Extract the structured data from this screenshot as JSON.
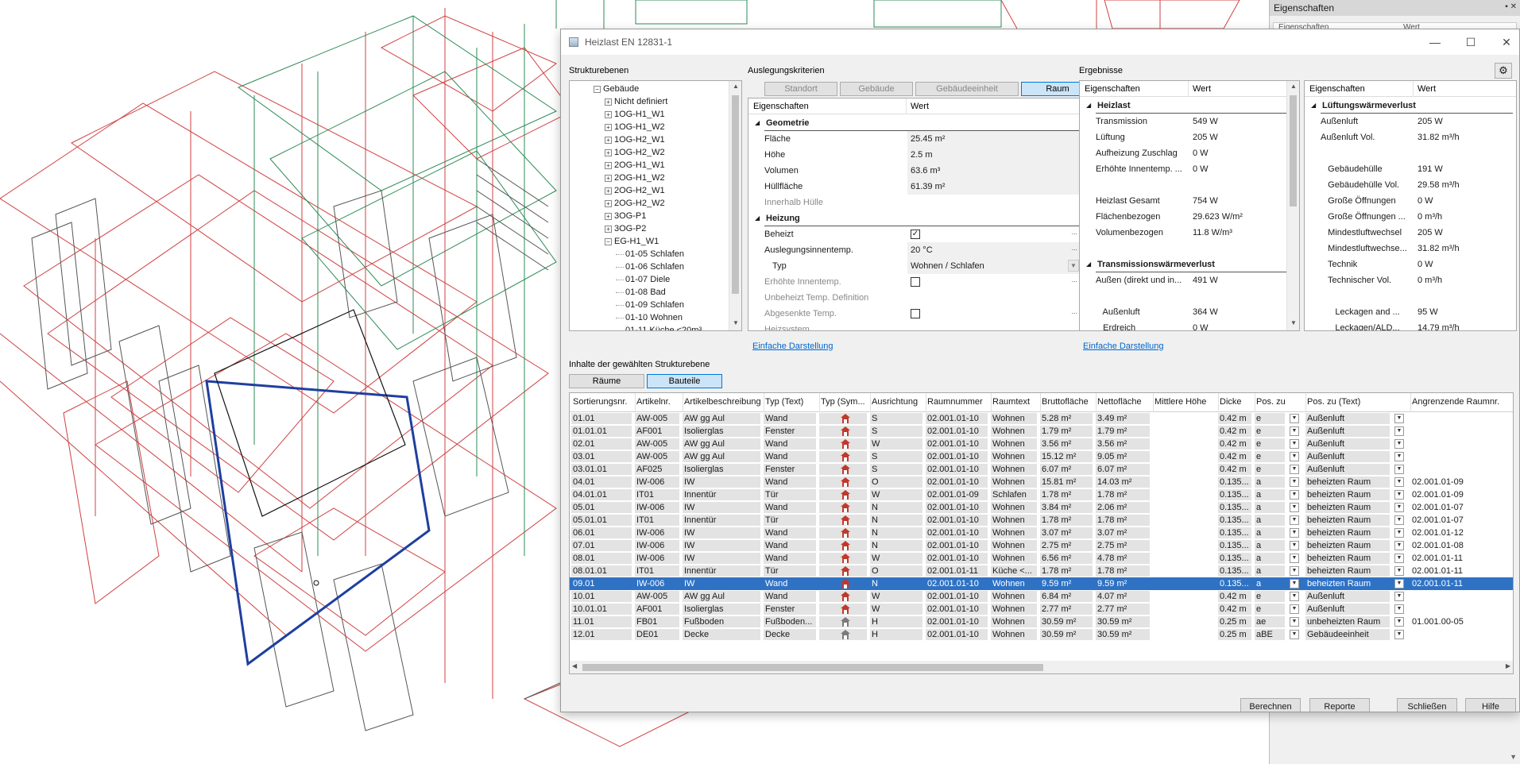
{
  "window": {
    "title": "Heizlast EN 12831-1",
    "controls": {
      "minimize": "—",
      "maximize": "☐",
      "close": "✕"
    }
  },
  "side_panel": {
    "title": "Eigenschaften",
    "header_left": "Eigenschaften",
    "header_right": "Wert"
  },
  "settings_icon": "gear-icon",
  "structure": {
    "label": "Strukturebenen",
    "items": [
      {
        "text": "Gebäude",
        "level": 0,
        "toggle": "−"
      },
      {
        "text": "Nicht definiert",
        "level": 1,
        "toggle": "+"
      },
      {
        "text": "1OG-H1_W1",
        "level": 1,
        "toggle": "+"
      },
      {
        "text": "1OG-H1_W2",
        "level": 1,
        "toggle": "+"
      },
      {
        "text": "1OG-H2_W1",
        "level": 1,
        "toggle": "+"
      },
      {
        "text": "1OG-H2_W2",
        "level": 1,
        "toggle": "+"
      },
      {
        "text": "2OG-H1_W1",
        "level": 1,
        "toggle": "+"
      },
      {
        "text": "2OG-H1_W2",
        "level": 1,
        "toggle": "+"
      },
      {
        "text": "2OG-H2_W1",
        "level": 1,
        "toggle": "+"
      },
      {
        "text": "2OG-H2_W2",
        "level": 1,
        "toggle": "+"
      },
      {
        "text": "3OG-P1",
        "level": 1,
        "toggle": "+"
      },
      {
        "text": "3OG-P2",
        "level": 1,
        "toggle": "+"
      },
      {
        "text": "EG-H1_W1",
        "level": 1,
        "toggle": "−"
      },
      {
        "text": "01-05 Schlafen",
        "level": 2,
        "toggle": ""
      },
      {
        "text": "01-06 Schlafen",
        "level": 2,
        "toggle": ""
      },
      {
        "text": "01-07 Diele",
        "level": 2,
        "toggle": ""
      },
      {
        "text": "01-08 Bad",
        "level": 2,
        "toggle": ""
      },
      {
        "text": "01-09 Schlafen",
        "level": 2,
        "toggle": ""
      },
      {
        "text": "01-10 Wohnen",
        "level": 2,
        "toggle": ""
      },
      {
        "text": "01-11 Küche <20m³",
        "level": 2,
        "toggle": ""
      }
    ]
  },
  "criteria": {
    "label": "Auslegungskriterien",
    "tabs": [
      "Standort",
      "Gebäude",
      "Gebäudeeinheit",
      "Raum"
    ],
    "active_tab": "Raum",
    "header": {
      "left": "Eigenschaften",
      "right": "Wert"
    },
    "rows": [
      {
        "type": "group",
        "label": "Geometrie"
      },
      {
        "type": "value",
        "label": "Fläche",
        "value": "25.45 m²"
      },
      {
        "type": "value",
        "label": "Höhe",
        "value": "2.5 m"
      },
      {
        "type": "value",
        "label": "Volumen",
        "value": "63.6 m³"
      },
      {
        "type": "value",
        "label": "Hüllfläche",
        "value": "61.39 m²"
      },
      {
        "type": "disabled",
        "label": "Innerhalb Hülle",
        "value": ""
      },
      {
        "type": "group",
        "label": "Heizung"
      },
      {
        "type": "check",
        "label": "Beheizt",
        "checked": true,
        "ellipsis": "..."
      },
      {
        "type": "value",
        "label": "Auslegungsinnentemp.",
        "value": "20 °C",
        "ellipsis": "..."
      },
      {
        "type": "dropdown",
        "label": "Typ",
        "value": "Wohnen / Schlafen"
      },
      {
        "type": "check-disabled",
        "label": "Erhöhte Innentemp.",
        "checked": false,
        "ellipsis": "..."
      },
      {
        "type": "disabled",
        "label": "Unbeheizt Temp. Definition",
        "value": ""
      },
      {
        "type": "check-disabled",
        "label": "Abgesenkte Temp.",
        "checked": false,
        "ellipsis": "..."
      },
      {
        "type": "disabled",
        "label": "Heizsystem",
        "value": ""
      }
    ],
    "link": "Einfache Darstellung"
  },
  "results": {
    "label": "Ergebnisse",
    "link": "Einfache Darstellung",
    "left": {
      "header": {
        "left": "Eigenschaften",
        "right": "Wert"
      },
      "rows": [
        {
          "type": "group",
          "label": "Heizlast"
        },
        {
          "type": "value",
          "label": "Transmission",
          "value": "549 W"
        },
        {
          "type": "value",
          "label": "Lüftung",
          "value": "205 W"
        },
        {
          "type": "value",
          "label": "Aufheizung Zuschlag",
          "value": "0 W"
        },
        {
          "type": "value",
          "label": "Erhöhte Innentemp. ...",
          "value": "0 W"
        },
        {
          "type": "blank"
        },
        {
          "type": "value",
          "label": "Heizlast Gesamt",
          "value": "754 W"
        },
        {
          "type": "value",
          "label": "Flächenbezogen",
          "value": "29.623 W/m²"
        },
        {
          "type": "value",
          "label": "Volumenbezogen",
          "value": "11.8 W/m³"
        },
        {
          "type": "blank"
        },
        {
          "type": "group",
          "label": "Transmissionswärmeverlust"
        },
        {
          "type": "value",
          "label": "Außen (direkt und in...",
          "value": "491 W"
        },
        {
          "type": "blank"
        },
        {
          "type": "value",
          "label": "   Außenluft",
          "value": "364 W"
        },
        {
          "type": "value",
          "label": "   Erdreich",
          "value": "0 W"
        }
      ]
    },
    "right": {
      "header": {
        "left": "Eigenschaften",
        "right": "Wert"
      },
      "rows": [
        {
          "type": "group",
          "label": "Lüftungswärmeverlust"
        },
        {
          "type": "value",
          "label": "Außenluft",
          "value": "205 W"
        },
        {
          "type": "value",
          "label": "Außenluft Vol.",
          "value": "31.82 m³/h"
        },
        {
          "type": "blank"
        },
        {
          "type": "value",
          "label": "   Gebäudehülle",
          "value": "191 W"
        },
        {
          "type": "value",
          "label": "   Gebäudehülle Vol.",
          "value": "29.58 m³/h"
        },
        {
          "type": "value",
          "label": "   Große Öffnungen",
          "value": "0 W"
        },
        {
          "type": "value",
          "label": "   Große Öffnungen ...",
          "value": "0 m³/h"
        },
        {
          "type": "value",
          "label": "   Mindestluftwechsel",
          "value": "205 W"
        },
        {
          "type": "value",
          "label": "   Mindestluftwechse...",
          "value": "31.82 m³/h"
        },
        {
          "type": "value",
          "label": "   Technik",
          "value": "0 W"
        },
        {
          "type": "value",
          "label": "   Technischer Vol.",
          "value": "0 m³/h"
        },
        {
          "type": "blank"
        },
        {
          "type": "value",
          "label": "      Leckagen and ...",
          "value": "95 W"
        },
        {
          "type": "value",
          "label": "      Leckagen/ALD...",
          "value": "14.79 m³/h"
        }
      ]
    }
  },
  "contents": {
    "label": "Inhalte der gewählten Strukturebene",
    "tabs": [
      "Räume",
      "Bauteile"
    ],
    "active_tab": "Bauteile",
    "columns": [
      "Sortierungsnr.",
      "Artikelnr.",
      "Artikelbeschreibung",
      "Typ (Text)",
      "Typ (Sym...",
      "Ausrichtung",
      "Raumnummer",
      "Raumtext",
      "Bruttofläche",
      "Nettofläche",
      "Mittlere Höhe",
      "Dicke",
      "Pos. zu",
      "Pos. zu (Text)",
      "Angrenzende Raumnr."
    ],
    "rows": [
      {
        "sort": "01.01",
        "art": "AW-005",
        "desc": "AW gg Aul",
        "typ": "Wand",
        "sym": "wall-symbol-icon",
        "ausr": "S",
        "raum": "02.001.01-10",
        "rtext": "Wohnen",
        "brutto": "5.28 m²",
        "netto": "3.49 m²",
        "hoehe": "",
        "dicke": "0.42 m",
        "pos": "e",
        "postext": "Außenluft",
        "angr": ""
      },
      {
        "sort": "01.01.01",
        "art": "AF001",
        "desc": "Isolierglas",
        "typ": "Fenster",
        "sym": "window-symbol-icon",
        "ausr": "S",
        "raum": "02.001.01-10",
        "rtext": "Wohnen",
        "brutto": "1.79 m²",
        "netto": "1.79 m²",
        "hoehe": "",
        "dicke": "0.42 m",
        "pos": "e",
        "postext": "Außenluft",
        "angr": ""
      },
      {
        "sort": "02.01",
        "art": "AW-005",
        "desc": "AW gg Aul",
        "typ": "Wand",
        "sym": "wall-symbol-icon",
        "ausr": "W",
        "raum": "02.001.01-10",
        "rtext": "Wohnen",
        "brutto": "3.56 m²",
        "netto": "3.56 m²",
        "hoehe": "",
        "dicke": "0.42 m",
        "pos": "e",
        "postext": "Außenluft",
        "angr": ""
      },
      {
        "sort": "03.01",
        "art": "AW-005",
        "desc": "AW gg Aul",
        "typ": "Wand",
        "sym": "wall-symbol-icon",
        "ausr": "S",
        "raum": "02.001.01-10",
        "rtext": "Wohnen",
        "brutto": "15.12 m²",
        "netto": "9.05 m²",
        "hoehe": "",
        "dicke": "0.42 m",
        "pos": "e",
        "postext": "Außenluft",
        "angr": ""
      },
      {
        "sort": "03.01.01",
        "art": "AF025",
        "desc": "Isolierglas",
        "typ": "Fenster",
        "sym": "window-symbol-icon",
        "ausr": "S",
        "raum": "02.001.01-10",
        "rtext": "Wohnen",
        "brutto": "6.07 m²",
        "netto": "6.07 m²",
        "hoehe": "",
        "dicke": "0.42 m",
        "pos": "e",
        "postext": "Außenluft",
        "angr": ""
      },
      {
        "sort": "04.01",
        "art": "IW-006",
        "desc": "IW",
        "typ": "Wand",
        "sym": "wall-symbol-icon",
        "ausr": "O",
        "raum": "02.001.01-10",
        "rtext": "Wohnen",
        "brutto": "15.81 m²",
        "netto": "14.03 m²",
        "hoehe": "",
        "dicke": "0.135...",
        "pos": "a",
        "postext": "beheizten Raum",
        "angr": "02.001.01-09"
      },
      {
        "sort": "04.01.01",
        "art": "IT01",
        "desc": "Innentür",
        "typ": "Tür",
        "sym": "door-symbol-icon",
        "ausr": "W",
        "raum": "02.001.01-09",
        "rtext": "Schlafen",
        "brutto": "1.78 m²",
        "netto": "1.78 m²",
        "hoehe": "",
        "dicke": "0.135...",
        "pos": "a",
        "postext": "beheizten Raum",
        "angr": "02.001.01-09"
      },
      {
        "sort": "05.01",
        "art": "IW-006",
        "desc": "IW",
        "typ": "Wand",
        "sym": "wall-symbol-icon",
        "ausr": "N",
        "raum": "02.001.01-10",
        "rtext": "Wohnen",
        "brutto": "3.84 m²",
        "netto": "2.06 m²",
        "hoehe": "",
        "dicke": "0.135...",
        "pos": "a",
        "postext": "beheizten Raum",
        "angr": "02.001.01-07"
      },
      {
        "sort": "05.01.01",
        "art": "IT01",
        "desc": "Innentür",
        "typ": "Tür",
        "sym": "door-symbol-icon",
        "ausr": "N",
        "raum": "02.001.01-10",
        "rtext": "Wohnen",
        "brutto": "1.78 m²",
        "netto": "1.78 m²",
        "hoehe": "",
        "dicke": "0.135...",
        "pos": "a",
        "postext": "beheizten Raum",
        "angr": "02.001.01-07"
      },
      {
        "sort": "06.01",
        "art": "IW-006",
        "desc": "IW",
        "typ": "Wand",
        "sym": "wall-symbol-icon",
        "ausr": "N",
        "raum": "02.001.01-10",
        "rtext": "Wohnen",
        "brutto": "3.07 m²",
        "netto": "3.07 m²",
        "hoehe": "",
        "dicke": "0.135...",
        "pos": "a",
        "postext": "beheizten Raum",
        "angr": "02.001.01-12"
      },
      {
        "sort": "07.01",
        "art": "IW-006",
        "desc": "IW",
        "typ": "Wand",
        "sym": "wall-symbol-icon",
        "ausr": "N",
        "raum": "02.001.01-10",
        "rtext": "Wohnen",
        "brutto": "2.75 m²",
        "netto": "2.75 m²",
        "hoehe": "",
        "dicke": "0.135...",
        "pos": "a",
        "postext": "beheizten Raum",
        "angr": "02.001.01-08"
      },
      {
        "sort": "08.01",
        "art": "IW-006",
        "desc": "IW",
        "typ": "Wand",
        "sym": "wall-symbol-icon",
        "ausr": "W",
        "raum": "02.001.01-10",
        "rtext": "Wohnen",
        "brutto": "6.56 m²",
        "netto": "4.78 m²",
        "hoehe": "",
        "dicke": "0.135...",
        "pos": "a",
        "postext": "beheizten Raum",
        "angr": "02.001.01-11"
      },
      {
        "sort": "08.01.01",
        "art": "IT01",
        "desc": "Innentür",
        "typ": "Tür",
        "sym": "door-symbol-icon",
        "ausr": "O",
        "raum": "02.001.01-11",
        "rtext": "Küche <...",
        "brutto": "1.78 m²",
        "netto": "1.78 m²",
        "hoehe": "",
        "dicke": "0.135...",
        "pos": "a",
        "postext": "beheizten Raum",
        "angr": "02.001.01-11"
      },
      {
        "sort": "09.01",
        "art": "IW-006",
        "desc": "IW",
        "typ": "Wand",
        "sym": "wall-symbol-icon",
        "ausr": "N",
        "raum": "02.001.01-10",
        "rtext": "Wohnen",
        "brutto": "9.59 m²",
        "netto": "9.59 m²",
        "hoehe": "",
        "dicke": "0.135...",
        "pos": "a",
        "postext": "beheizten Raum",
        "angr": "02.001.01-11",
        "selected": true
      },
      {
        "sort": "10.01",
        "art": "AW-005",
        "desc": "AW gg Aul",
        "typ": "Wand",
        "sym": "wall-symbol-icon",
        "ausr": "W",
        "raum": "02.001.01-10",
        "rtext": "Wohnen",
        "brutto": "6.84 m²",
        "netto": "4.07 m²",
        "hoehe": "",
        "dicke": "0.42 m",
        "pos": "e",
        "postext": "Außenluft",
        "angr": ""
      },
      {
        "sort": "10.01.01",
        "art": "AF001",
        "desc": "Isolierglas",
        "typ": "Fenster",
        "sym": "window-symbol-icon",
        "ausr": "W",
        "raum": "02.001.01-10",
        "rtext": "Wohnen",
        "brutto": "2.77 m²",
        "netto": "2.77 m²",
        "hoehe": "",
        "dicke": "0.42 m",
        "pos": "e",
        "postext": "Außenluft",
        "angr": ""
      },
      {
        "sort": "11.01",
        "art": "FB01",
        "desc": "Fußboden",
        "typ": "Fußboden...",
        "sym": "floor-symbol-icon",
        "ausr": "H",
        "raum": "02.001.01-10",
        "rtext": "Wohnen",
        "brutto": "30.59 m²",
        "netto": "30.59 m²",
        "hoehe": "",
        "dicke": "0.25 m",
        "pos": "ae",
        "postext": "unbeheizten Raum",
        "angr": "01.001.00-05"
      },
      {
        "sort": "12.01",
        "art": "DE01",
        "desc": "Decke",
        "typ": "Decke",
        "sym": "ceiling-symbol-icon",
        "ausr": "H",
        "raum": "02.001.01-10",
        "rtext": "Wohnen",
        "brutto": "30.59 m²",
        "netto": "30.59 m²",
        "hoehe": "",
        "dicke": "0.25 m",
        "pos": "aBE",
        "postext": "Gebäudeeinheit",
        "angr": ""
      }
    ]
  },
  "buttons": [
    "Berechnen",
    "Reporte",
    "Schließen",
    "Hilfe"
  ],
  "colors": {
    "selection": "#2f72c4",
    "tab_active": "#cce4f7",
    "link": "#0066cc",
    "cad_red": "#d04040",
    "cad_green": "#2e8b57",
    "cad_blue": "#1f3f9f"
  }
}
